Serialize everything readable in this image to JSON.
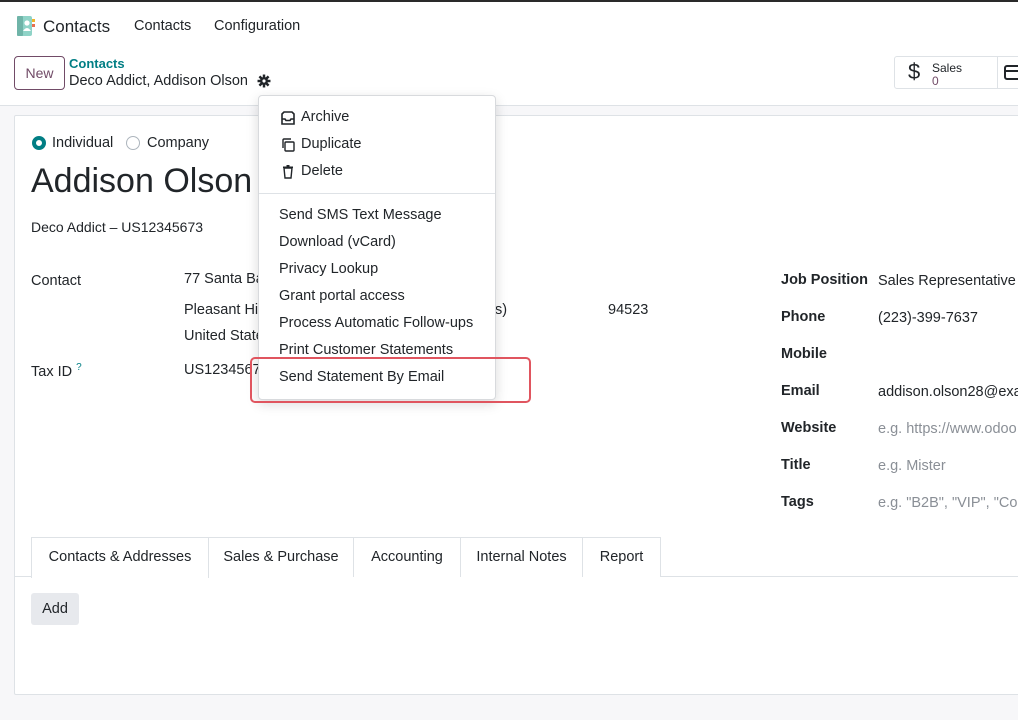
{
  "topbar": {
    "app_name": "Contacts",
    "menu": [
      "Contacts",
      "Configuration"
    ]
  },
  "control_panel": {
    "new_label": "New",
    "breadcrumb_parent": "Contacts",
    "breadcrumb_current": "Deco Addict, Addison Olson",
    "smart_sales_label": "Sales",
    "smart_sales_value": "0",
    "smart_sales_symbol": "$"
  },
  "form": {
    "type_individual": "Individual",
    "type_company": "Company",
    "name": "Addison Olson",
    "company_line": "Deco Addict – US12345673",
    "contact_label": "Contact",
    "street": "77 Santa Ba",
    "city": "Pleasant Hi",
    "state_suffix": "s)",
    "zip": "94523",
    "country": "United State",
    "tax_label": "Tax ID",
    "tax_help": "?",
    "tax_value": "US1234567",
    "job_position_label": "Job Position",
    "job_position_value": "Sales Representative",
    "phone_label": "Phone",
    "phone_value": "(223)-399-7637",
    "mobile_label": "Mobile",
    "email_label": "Email",
    "email_value": "addison.olson28@exa",
    "website_label": "Website",
    "website_placeholder": "e.g. https://www.odoo",
    "title_label": "Title",
    "title_placeholder": "e.g. Mister",
    "tags_label": "Tags",
    "tags_placeholder": "e.g. \"B2B\", \"VIP\", \"Co"
  },
  "tabs": [
    "Contacts & Addresses",
    "Sales & Purchase",
    "Accounting",
    "Internal Notes",
    "Report"
  ],
  "add_label": "Add",
  "action_menu": {
    "archive": "Archive",
    "duplicate": "Duplicate",
    "delete": "Delete",
    "items": [
      "Send SMS Text Message",
      "Download (vCard)",
      "Privacy Lookup",
      "Grant portal access",
      "Process Automatic Follow-ups",
      "Print Customer Statements",
      "Send Statement By Email"
    ]
  },
  "colors": {
    "brand": "#714b67",
    "accent": "#017e84",
    "highlight": "#e0555f"
  }
}
